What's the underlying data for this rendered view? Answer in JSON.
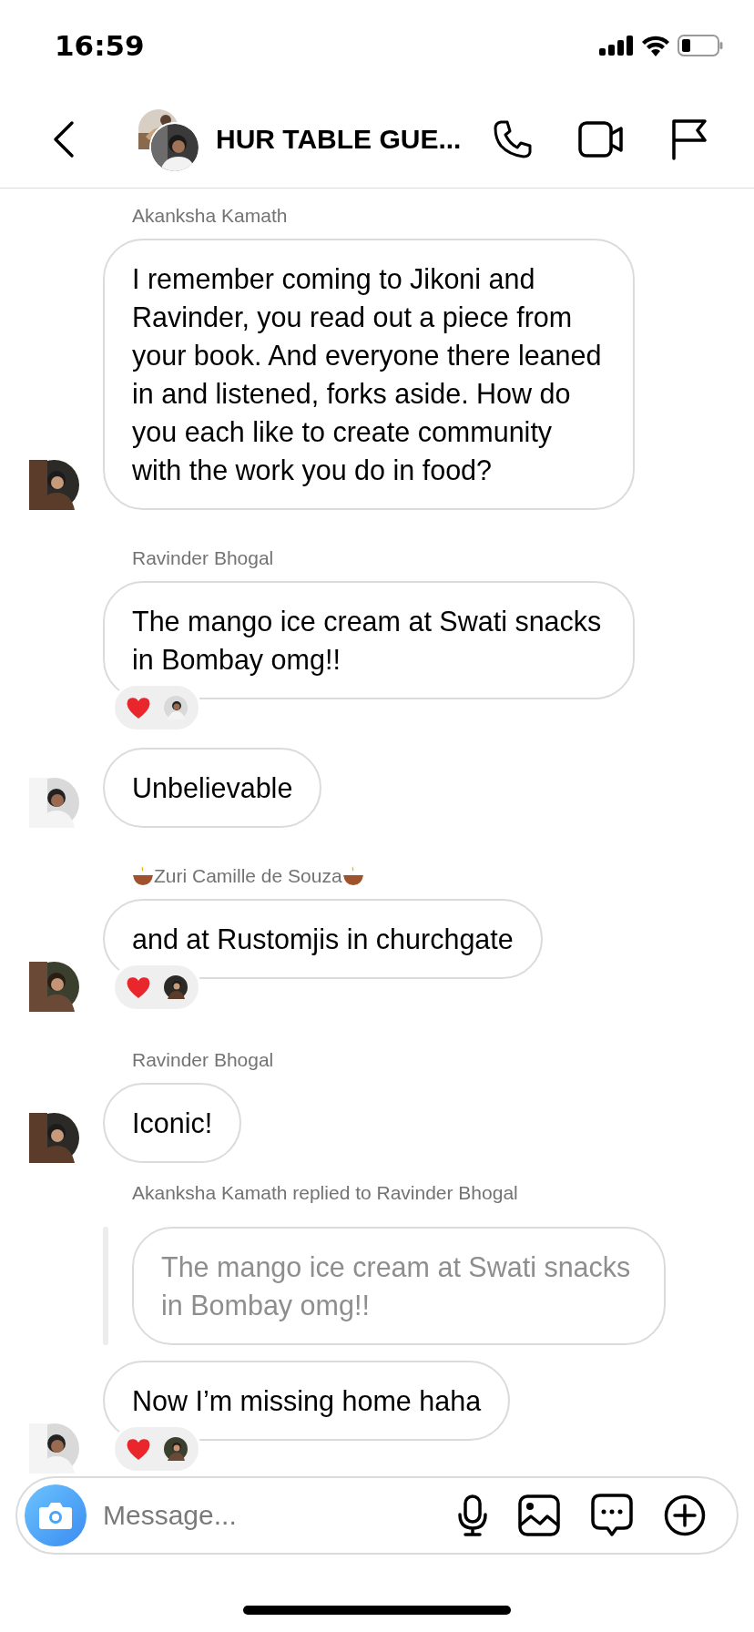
{
  "status_bar": {
    "time": "16:59"
  },
  "header": {
    "title": "HUR TABLE GUE..."
  },
  "messages": [
    {
      "kind": "message",
      "sender": "Akanksha Kamath",
      "decorated": false,
      "text": "I remember coming to Jikoni and Ravinder, you read out a piece from your book. And everyone there leaned in and listened, forks aside. How do you each like to create community with the work you do in food?",
      "avatar": true,
      "reaction": false
    },
    {
      "kind": "message",
      "sender": "Ravinder Bhogal",
      "decorated": false,
      "text": "The mango ice cream at Swati snacks in Bombay omg!!",
      "avatar": false,
      "reaction": true
    },
    {
      "kind": "message",
      "text": "Unbelievable",
      "avatar": true,
      "reaction": false
    },
    {
      "kind": "message",
      "sender": "Zuri Camille de Souza",
      "decorated": true,
      "text": "and at Rustomjis in churchgate",
      "avatar": true,
      "reaction": true
    },
    {
      "kind": "message",
      "sender": "Ravinder Bhogal",
      "decorated": false,
      "text": "Iconic!",
      "avatar": true,
      "reaction": false
    },
    {
      "kind": "reply",
      "label": "Akanksha Kamath replied to Ravinder Bhogal",
      "quote": "The mango ice cream at Swati snacks in Bombay omg!!"
    },
    {
      "kind": "message",
      "text": "Now I’m missing home haha",
      "avatar": true,
      "reaction": true
    }
  ],
  "composer": {
    "placeholder": "Message..."
  }
}
